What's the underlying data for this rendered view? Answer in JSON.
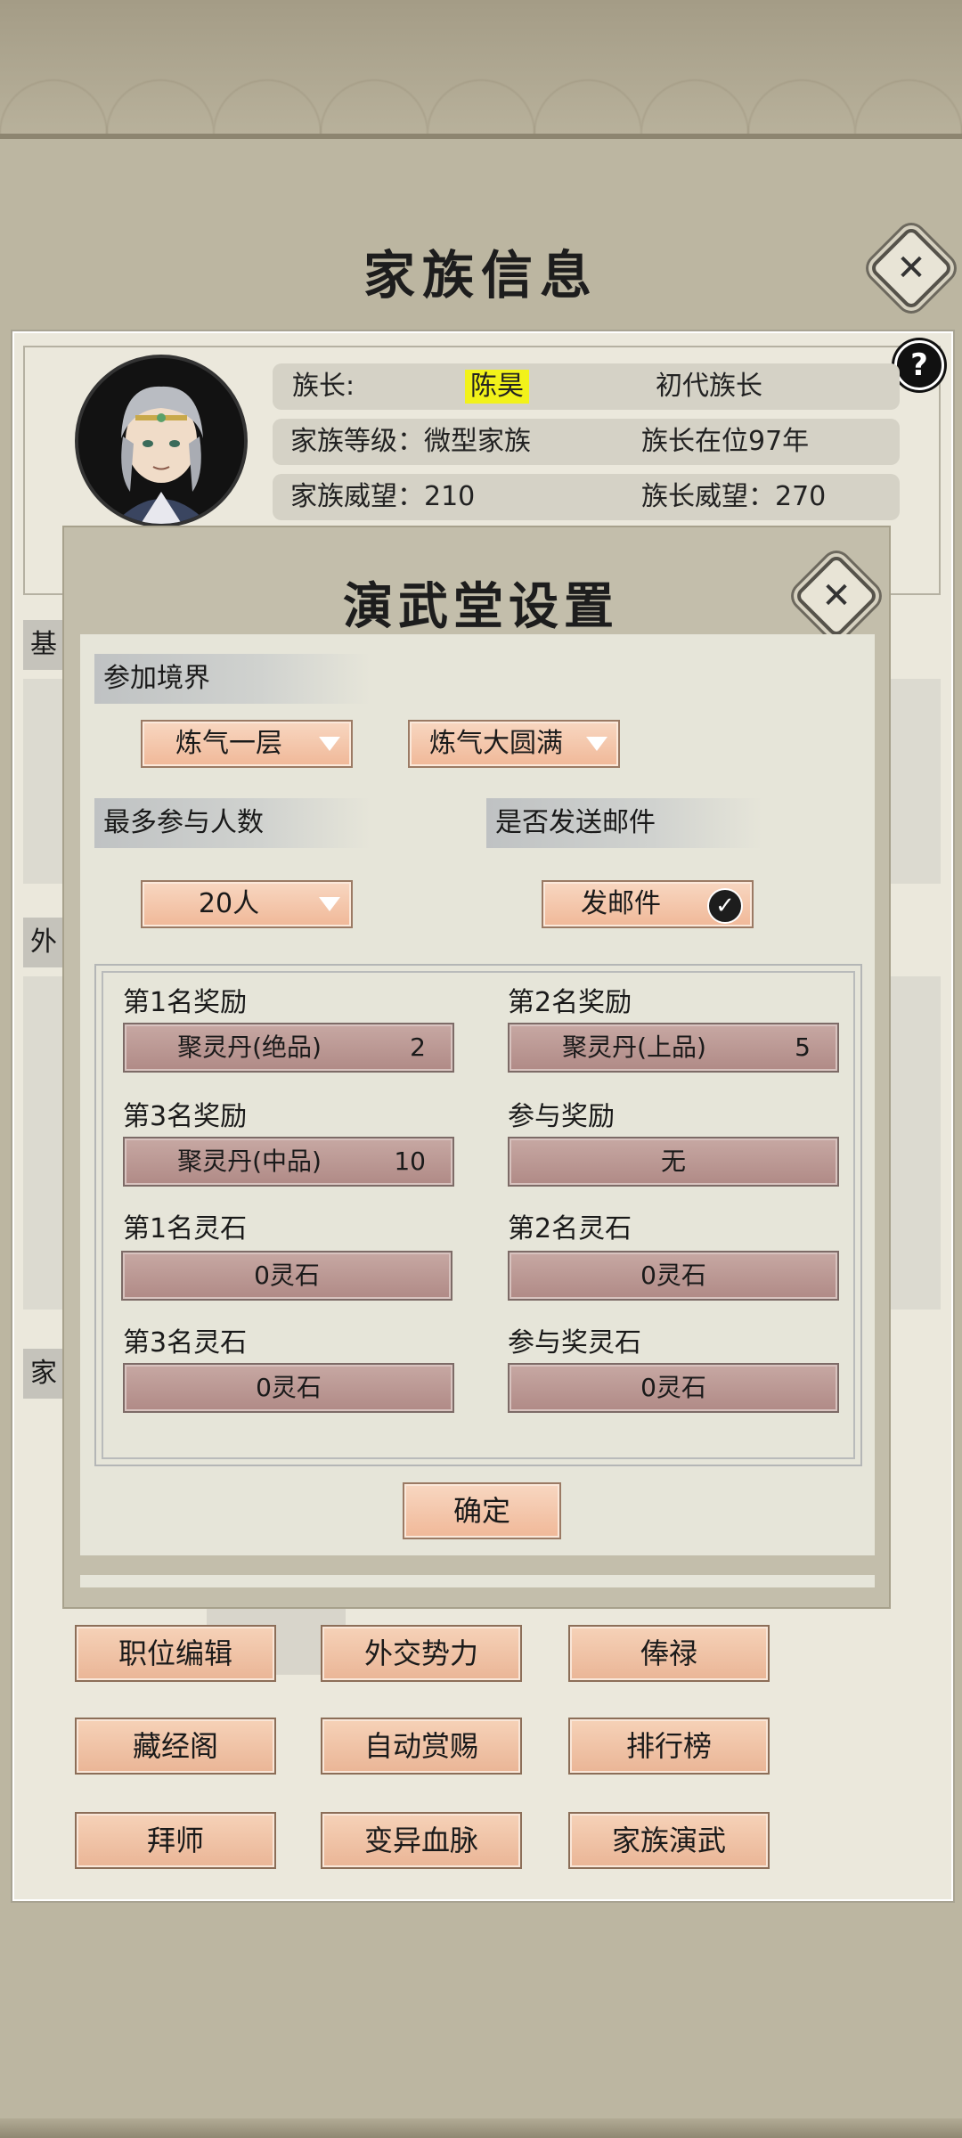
{
  "page": {
    "title": "家族信息"
  },
  "family": {
    "leader_label": "族长:",
    "leader_name": "陈昊",
    "leader_title": "初代族长",
    "level_text": "家族等级：微型家族",
    "tenure_text": "族长在位97年",
    "family_prestige_text": "家族威望：210",
    "leader_prestige_text": "族长威望：270"
  },
  "side_tabs": [
    "基",
    "外",
    "家"
  ],
  "bottom_buttons": [
    [
      "职位编辑",
      "外交势力",
      "俸禄"
    ],
    [
      "藏经阁",
      "自动赏赐",
      "排行榜"
    ],
    [
      "拜师",
      "变异血脉",
      "家族演武"
    ]
  ],
  "dialog": {
    "title": "演武堂设置",
    "realm_label": "参加境界",
    "realm_from": "炼气一层",
    "realm_to": "炼气大圆满",
    "max_participants_label": "最多参与人数",
    "max_participants_value": "20人",
    "send_mail_label": "是否发送邮件",
    "send_mail_value": "发邮件",
    "send_mail_checked": true,
    "rewards": {
      "first_label": "第1名奖励",
      "first_item": "聚灵丹(绝品)",
      "first_qty": "2",
      "second_label": "第2名奖励",
      "second_item": "聚灵丹(上品)",
      "second_qty": "5",
      "third_label": "第3名奖励",
      "third_item": "聚灵丹(中品)",
      "third_qty": "10",
      "participation_label": "参与奖励",
      "participation_value": "无",
      "first_stone_label": "第1名灵石",
      "first_stone": "0灵石",
      "second_stone_label": "第2名灵石",
      "second_stone": "0灵石",
      "third_stone_label": "第3名灵石",
      "third_stone": "0灵石",
      "participation_stone_label": "参与奖灵石",
      "participation_stone": "0灵石"
    },
    "confirm_label": "确定"
  },
  "icons": {
    "close": "close-icon",
    "help": "?",
    "dropdown": "triangle-down-icon",
    "check": "✓"
  }
}
